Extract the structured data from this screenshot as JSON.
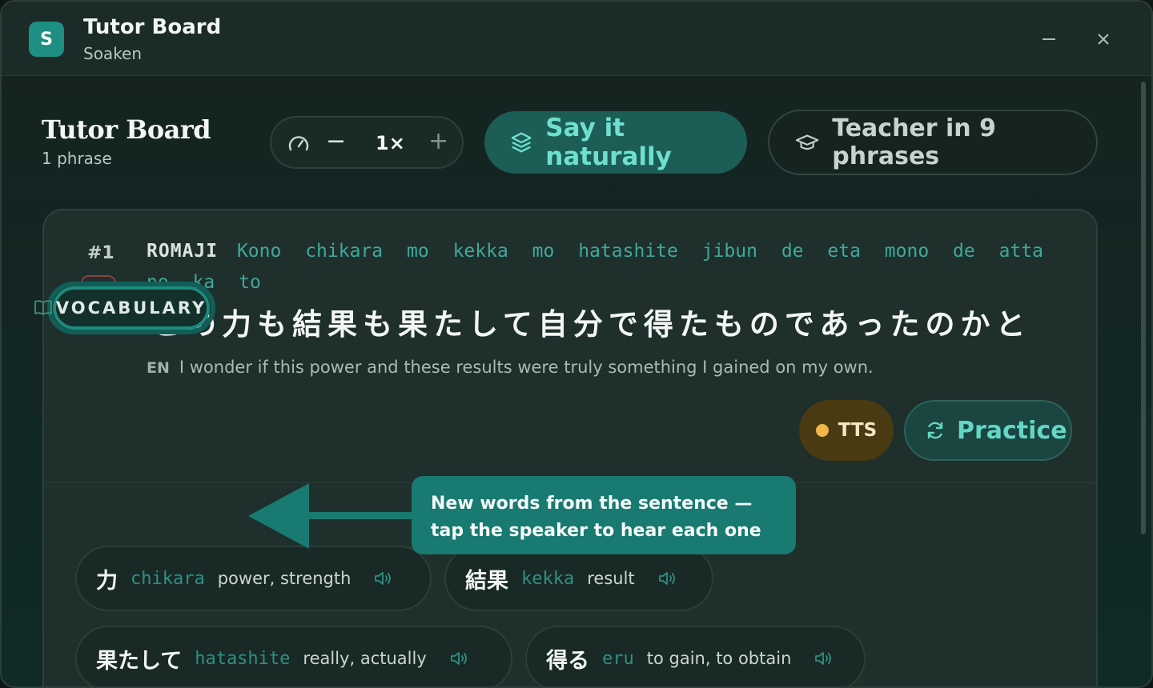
{
  "window": {
    "app_icon_letter": "S",
    "title": "Tutor Board",
    "subtitle": "Soaken",
    "minimize_glyph": "—",
    "close_glyph": "✕"
  },
  "header": {
    "title": "Tutor Board",
    "count": "1 phrase",
    "speed": {
      "minus": "−",
      "value": "1×",
      "plus": "+"
    },
    "say_naturally_label": "Say it naturally",
    "teacher_label": "Teacher in 9 phrases"
  },
  "phrase": {
    "number": "#1",
    "progress": "0%",
    "romaji_label": "ROMAJI",
    "romaji_words": [
      "Kono",
      "chikara",
      "mo",
      "kekka",
      "mo",
      "hatashite",
      "jibun",
      "de",
      "eta",
      "mono",
      "de",
      "atta",
      "no",
      "ka",
      "to"
    ],
    "japanese": "この力も結果も果たして自分で得たものであったのかと",
    "en_tag": "EN",
    "english": "I wonder if this power and these results were truly something I gained on my own.",
    "tts_label": "TTS",
    "practice_label": "Practice"
  },
  "vocabulary": {
    "label": "VOCABULARY",
    "items": [
      {
        "kanji": "力",
        "romaji": "chikara",
        "meaning": "power, strength"
      },
      {
        "kanji": "結果",
        "romaji": "kekka",
        "meaning": "result"
      },
      {
        "kanji": "果たして",
        "romaji": "hatashite",
        "meaning": "really, actually"
      },
      {
        "kanji": "得る",
        "romaji": "eru",
        "meaning": "to gain, to obtain"
      }
    ]
  },
  "tooltip": {
    "line1": "New words from the sentence —",
    "line2": "tap the speaker to hear each one"
  },
  "colors": {
    "accent": "#1f8f83",
    "romaji": "#3fa99c",
    "tts_dot": "#f2b748",
    "progress_badge": "#f08080"
  }
}
